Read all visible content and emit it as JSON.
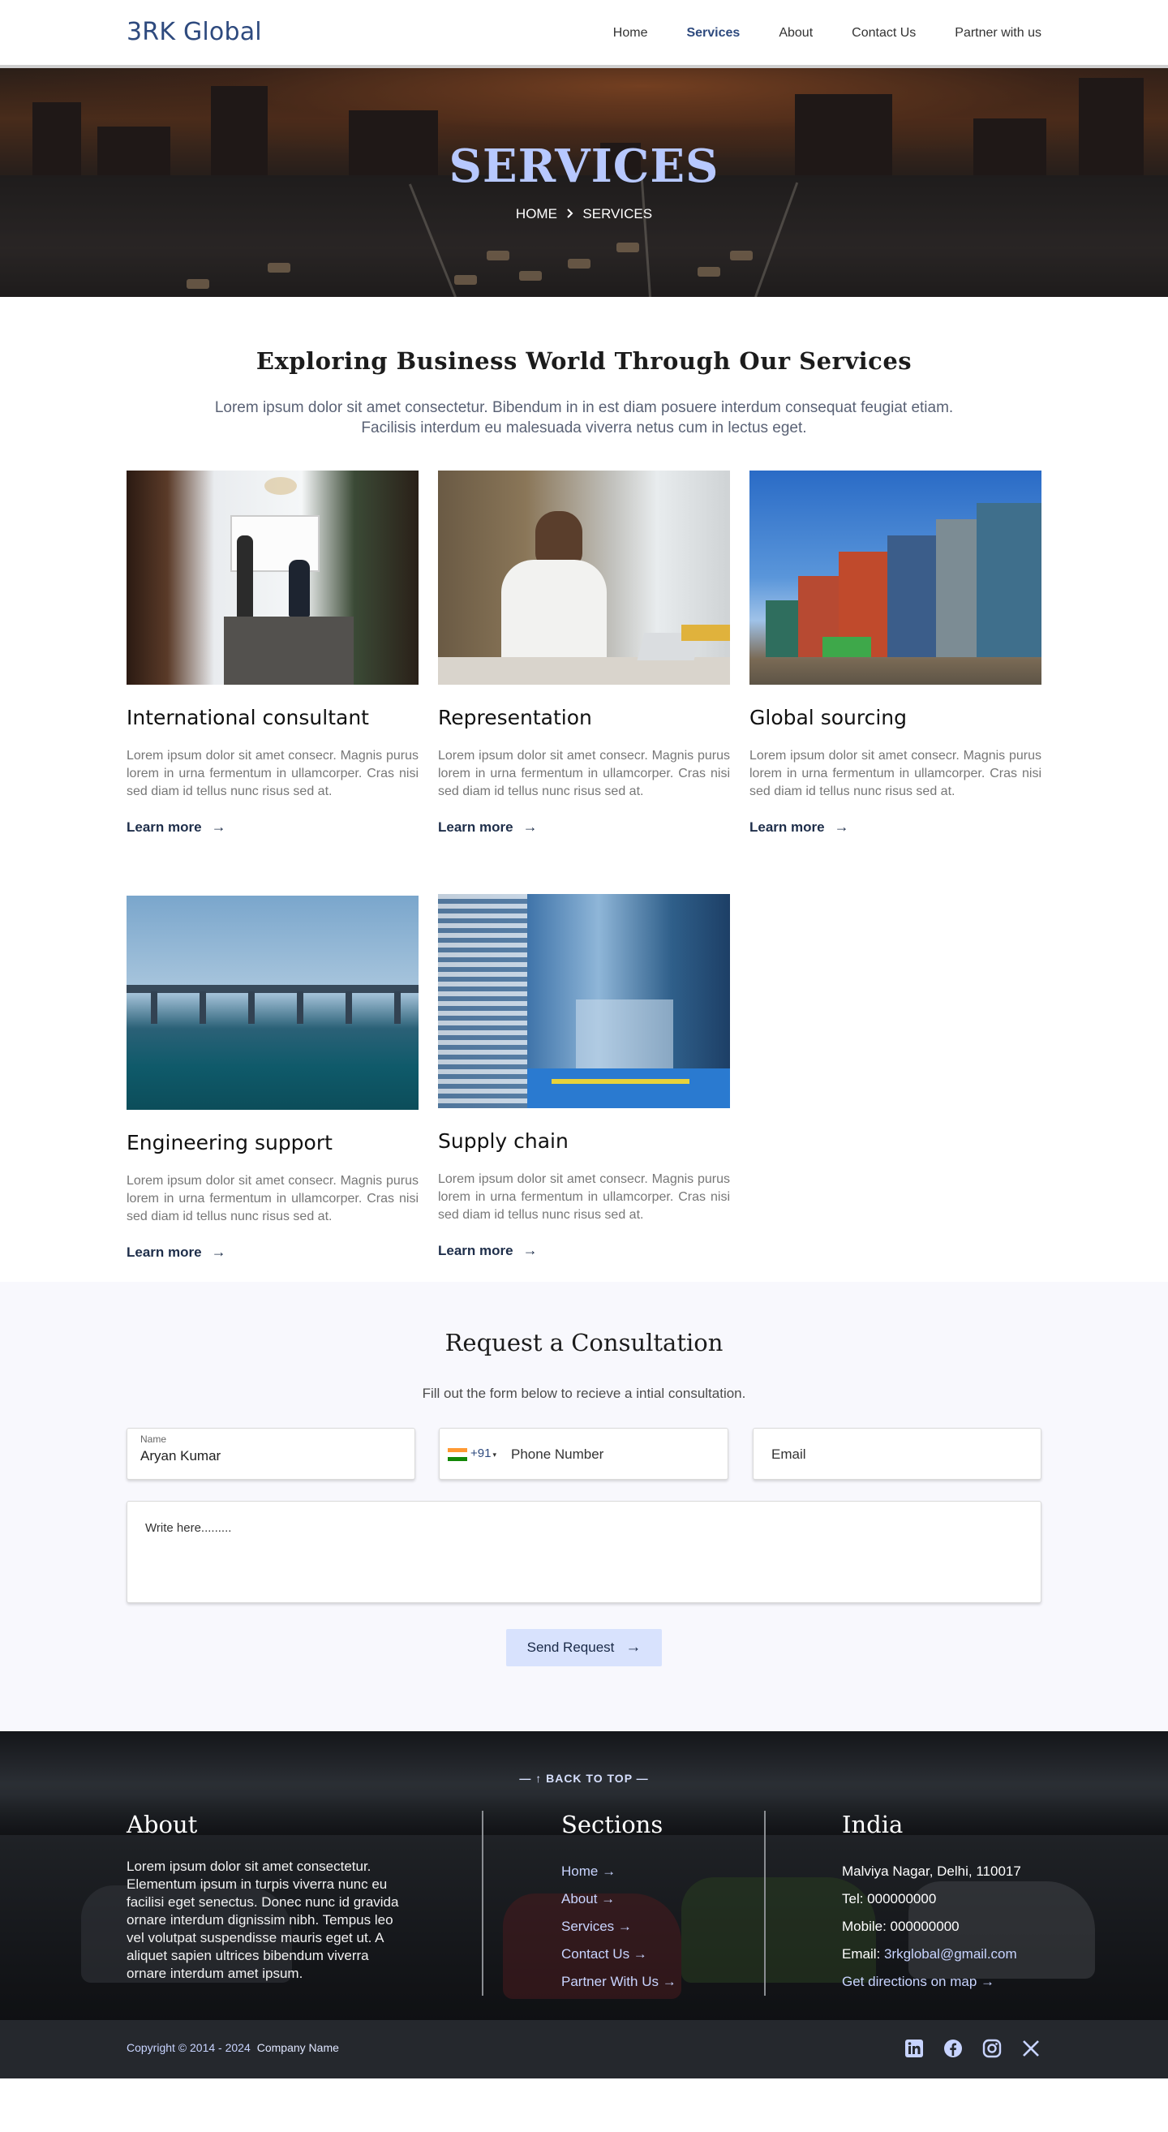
{
  "header": {
    "logo": "3RK Global",
    "nav": [
      {
        "label": "Home",
        "active": false
      },
      {
        "label": "Services",
        "active": true
      },
      {
        "label": "About",
        "active": false
      },
      {
        "label": "Contact Us",
        "active": false
      },
      {
        "label": "Partner with us",
        "active": false
      }
    ]
  },
  "hero": {
    "title": "SERVICES",
    "breadcrumb_home": "HOME",
    "breadcrumb_sep_icon": "chevron-right-icon",
    "breadcrumb_current": "SERVICES"
  },
  "intro": {
    "title": "Exploring Business World Through Our Services",
    "text": "Lorem ipsum dolor sit amet consectetur. Bibendum in in est diam posuere interdum consequat feugiat etiam. Facilisis interdum eu malesuada viverra netus cum in lectus eget."
  },
  "services": [
    {
      "title": "International consultant",
      "text": "Lorem ipsum dolor sit amet consecr. Magnis purus lorem in urna fermentum in ullamcorper. Cras nisi sed diam id tellus nunc risus sed at.",
      "link": "Learn more"
    },
    {
      "title": "Representation",
      "text": "Lorem ipsum dolor sit amet consecr. Magnis purus lorem in urna fermentum in ullamcorper. Cras nisi sed diam id tellus nunc risus sed at.",
      "link": "Learn more"
    },
    {
      "title": "Global sourcing",
      "text": "Lorem ipsum dolor sit amet consecr. Magnis purus lorem in urna fermentum in ullamcorper. Cras nisi sed diam id tellus nunc risus sed at.",
      "link": "Learn more"
    },
    {
      "title": "Engineering support",
      "text": "Lorem ipsum dolor sit amet consecr. Magnis purus lorem in urna fermentum in ullamcorper. Cras nisi sed diam id tellus nunc risus sed at.",
      "link": "Learn more"
    },
    {
      "title": "Supply chain",
      "text": "Lorem ipsum dolor sit amet consecr. Magnis purus lorem in urna fermentum in ullamcorper. Cras nisi sed diam id tellus nunc risus sed at.",
      "link": "Learn more"
    }
  ],
  "consultation": {
    "title": "Request a Consultation",
    "subtitle": "Fill out the form below to recieve a intial consultation.",
    "name_label": "Name",
    "name_value": "Aryan Kumar",
    "country_code": "+91",
    "phone_placeholder": "Phone Number",
    "email_placeholder": "Email",
    "message_placeholder": "Write here.........",
    "send_label": "Send Request"
  },
  "footer": {
    "back_to_top": "— ↑ BACK TO TOP —",
    "about_title": "About",
    "about_text": "Lorem ipsum dolor sit amet consectetur. Elementum ipsum in turpis viverra nunc eu facilisi eget senectus. Donec nunc id gravida ornare interdum dignissim nibh. Tempus leo vel volutpat suspendisse mauris eget ut. A aliquet sapien ultrices bibendum viverra ornare interdum amet ipsum.",
    "sections_title": "Sections",
    "sections": [
      "Home →",
      "About →",
      "Services →",
      "Contact Us →",
      "Partner With Us →"
    ],
    "india_title": "India",
    "address": "Malviya Nagar, Delhi, 110017",
    "tel": "Tel: 000000000",
    "mobile": "Mobile: 000000000",
    "email_label": "Email: ",
    "email": "3rkglobal@gmail.com",
    "directions": "Get directions on map →",
    "copyright": "Copyright © 2014 - 2024",
    "company": "Company Name",
    "socials": [
      "linkedin-icon",
      "facebook-icon",
      "instagram-icon",
      "x-icon"
    ]
  }
}
